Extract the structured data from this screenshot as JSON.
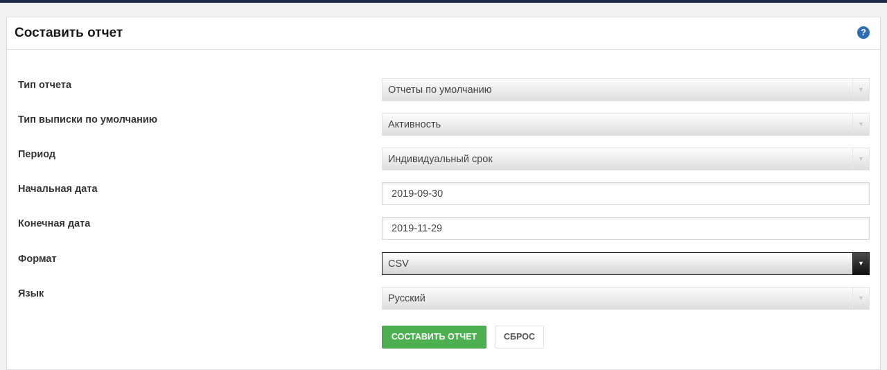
{
  "panel": {
    "title": "Составить отчет",
    "help_icon": "?"
  },
  "form": {
    "report_type": {
      "label": "Тип отчета",
      "value": "Отчеты по умолчанию"
    },
    "statement_type": {
      "label": "Тип выписки по умолчанию",
      "value": "Активность"
    },
    "period": {
      "label": "Период",
      "value": "Индивидуальный срок"
    },
    "start_date": {
      "label": "Начальная дата",
      "value": "2019-09-30"
    },
    "end_date": {
      "label": "Конечная дата",
      "value": "2019-11-29"
    },
    "format": {
      "label": "Формат",
      "value": "CSV"
    },
    "language": {
      "label": "Язык",
      "value": "Русский"
    }
  },
  "buttons": {
    "submit": "СОСТАВИТЬ ОТЧЕТ",
    "reset": "СБРОС"
  },
  "colors": {
    "accent_green": "#4caf50",
    "help_blue": "#2f6eb5",
    "top_bar": "#1c2b4a"
  },
  "icons": {
    "help": "question-circle-icon",
    "dropdown": "triangle-down-icon"
  }
}
